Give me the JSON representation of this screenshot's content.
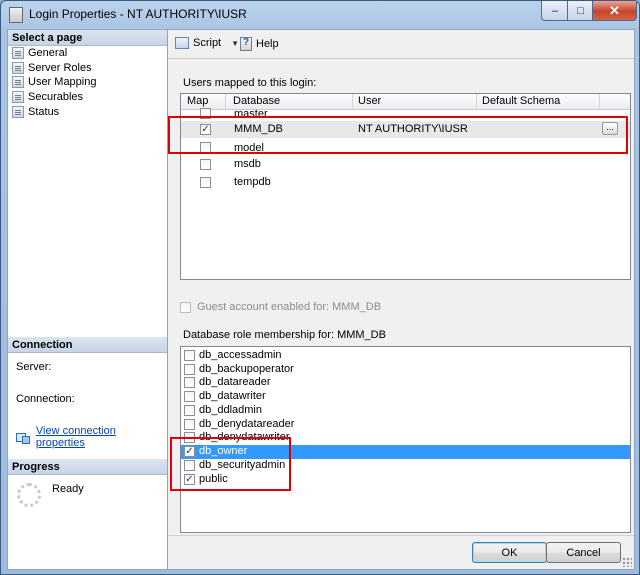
{
  "window": {
    "title": "Login Properties - NT AUTHORITY\\IUSR",
    "controls": {
      "minimize": "–",
      "maximize": "□",
      "close": "✕"
    }
  },
  "left_panel": {
    "select_page_header": "Select a page",
    "pages": [
      {
        "label": "General",
        "icon": "page-icon"
      },
      {
        "label": "Server Roles",
        "icon": "page-icon"
      },
      {
        "label": "User Mapping",
        "icon": "page-icon"
      },
      {
        "label": "Securables",
        "icon": "page-icon"
      },
      {
        "label": "Status",
        "icon": "page-icon"
      }
    ],
    "connection_header": "Connection",
    "server_label": "Server:",
    "connection_label": "Connection:",
    "view_connection_link": "View connection properties",
    "progress_header": "Progress",
    "progress_status": "Ready"
  },
  "toolbar": {
    "script_label": "Script",
    "help_label": "Help"
  },
  "users_mapped": {
    "label": "Users mapped to this login:",
    "columns": [
      "Map",
      "Database",
      "User",
      "Default Schema"
    ],
    "rows": [
      {
        "checked": false,
        "database": "master",
        "user": "",
        "schema": ""
      },
      {
        "checked": true,
        "database": "MMM_DB",
        "user": "NT AUTHORITY\\IUSR",
        "schema": ""
      },
      {
        "checked": false,
        "database": "model",
        "user": "",
        "schema": ""
      },
      {
        "checked": false,
        "database": "msdb",
        "user": "",
        "schema": ""
      },
      {
        "checked": false,
        "database": "tempdb",
        "user": "",
        "schema": ""
      }
    ],
    "ellipsis": "..."
  },
  "guest_account": {
    "label": "Guest account enabled for: MMM_DB",
    "checked": false
  },
  "role_membership": {
    "label": "Database role membership for: MMM_DB",
    "roles": [
      {
        "name": "db_accessadmin",
        "checked": false
      },
      {
        "name": "db_backupoperator",
        "checked": false
      },
      {
        "name": "db_datareader",
        "checked": false
      },
      {
        "name": "db_datawriter",
        "checked": false
      },
      {
        "name": "db_ddladmin",
        "checked": false
      },
      {
        "name": "db_denydatareader",
        "checked": false
      },
      {
        "name": "db_denydatawriter",
        "checked": false
      },
      {
        "name": "db_owner",
        "checked": true
      },
      {
        "name": "db_securityadmin",
        "checked": false
      },
      {
        "name": "public",
        "checked": true
      }
    ]
  },
  "buttons": {
    "ok": "OK",
    "cancel": "Cancel"
  },
  "colors": {
    "highlight": "#e00000",
    "selection": "#3399ff",
    "link": "#0645ad"
  }
}
